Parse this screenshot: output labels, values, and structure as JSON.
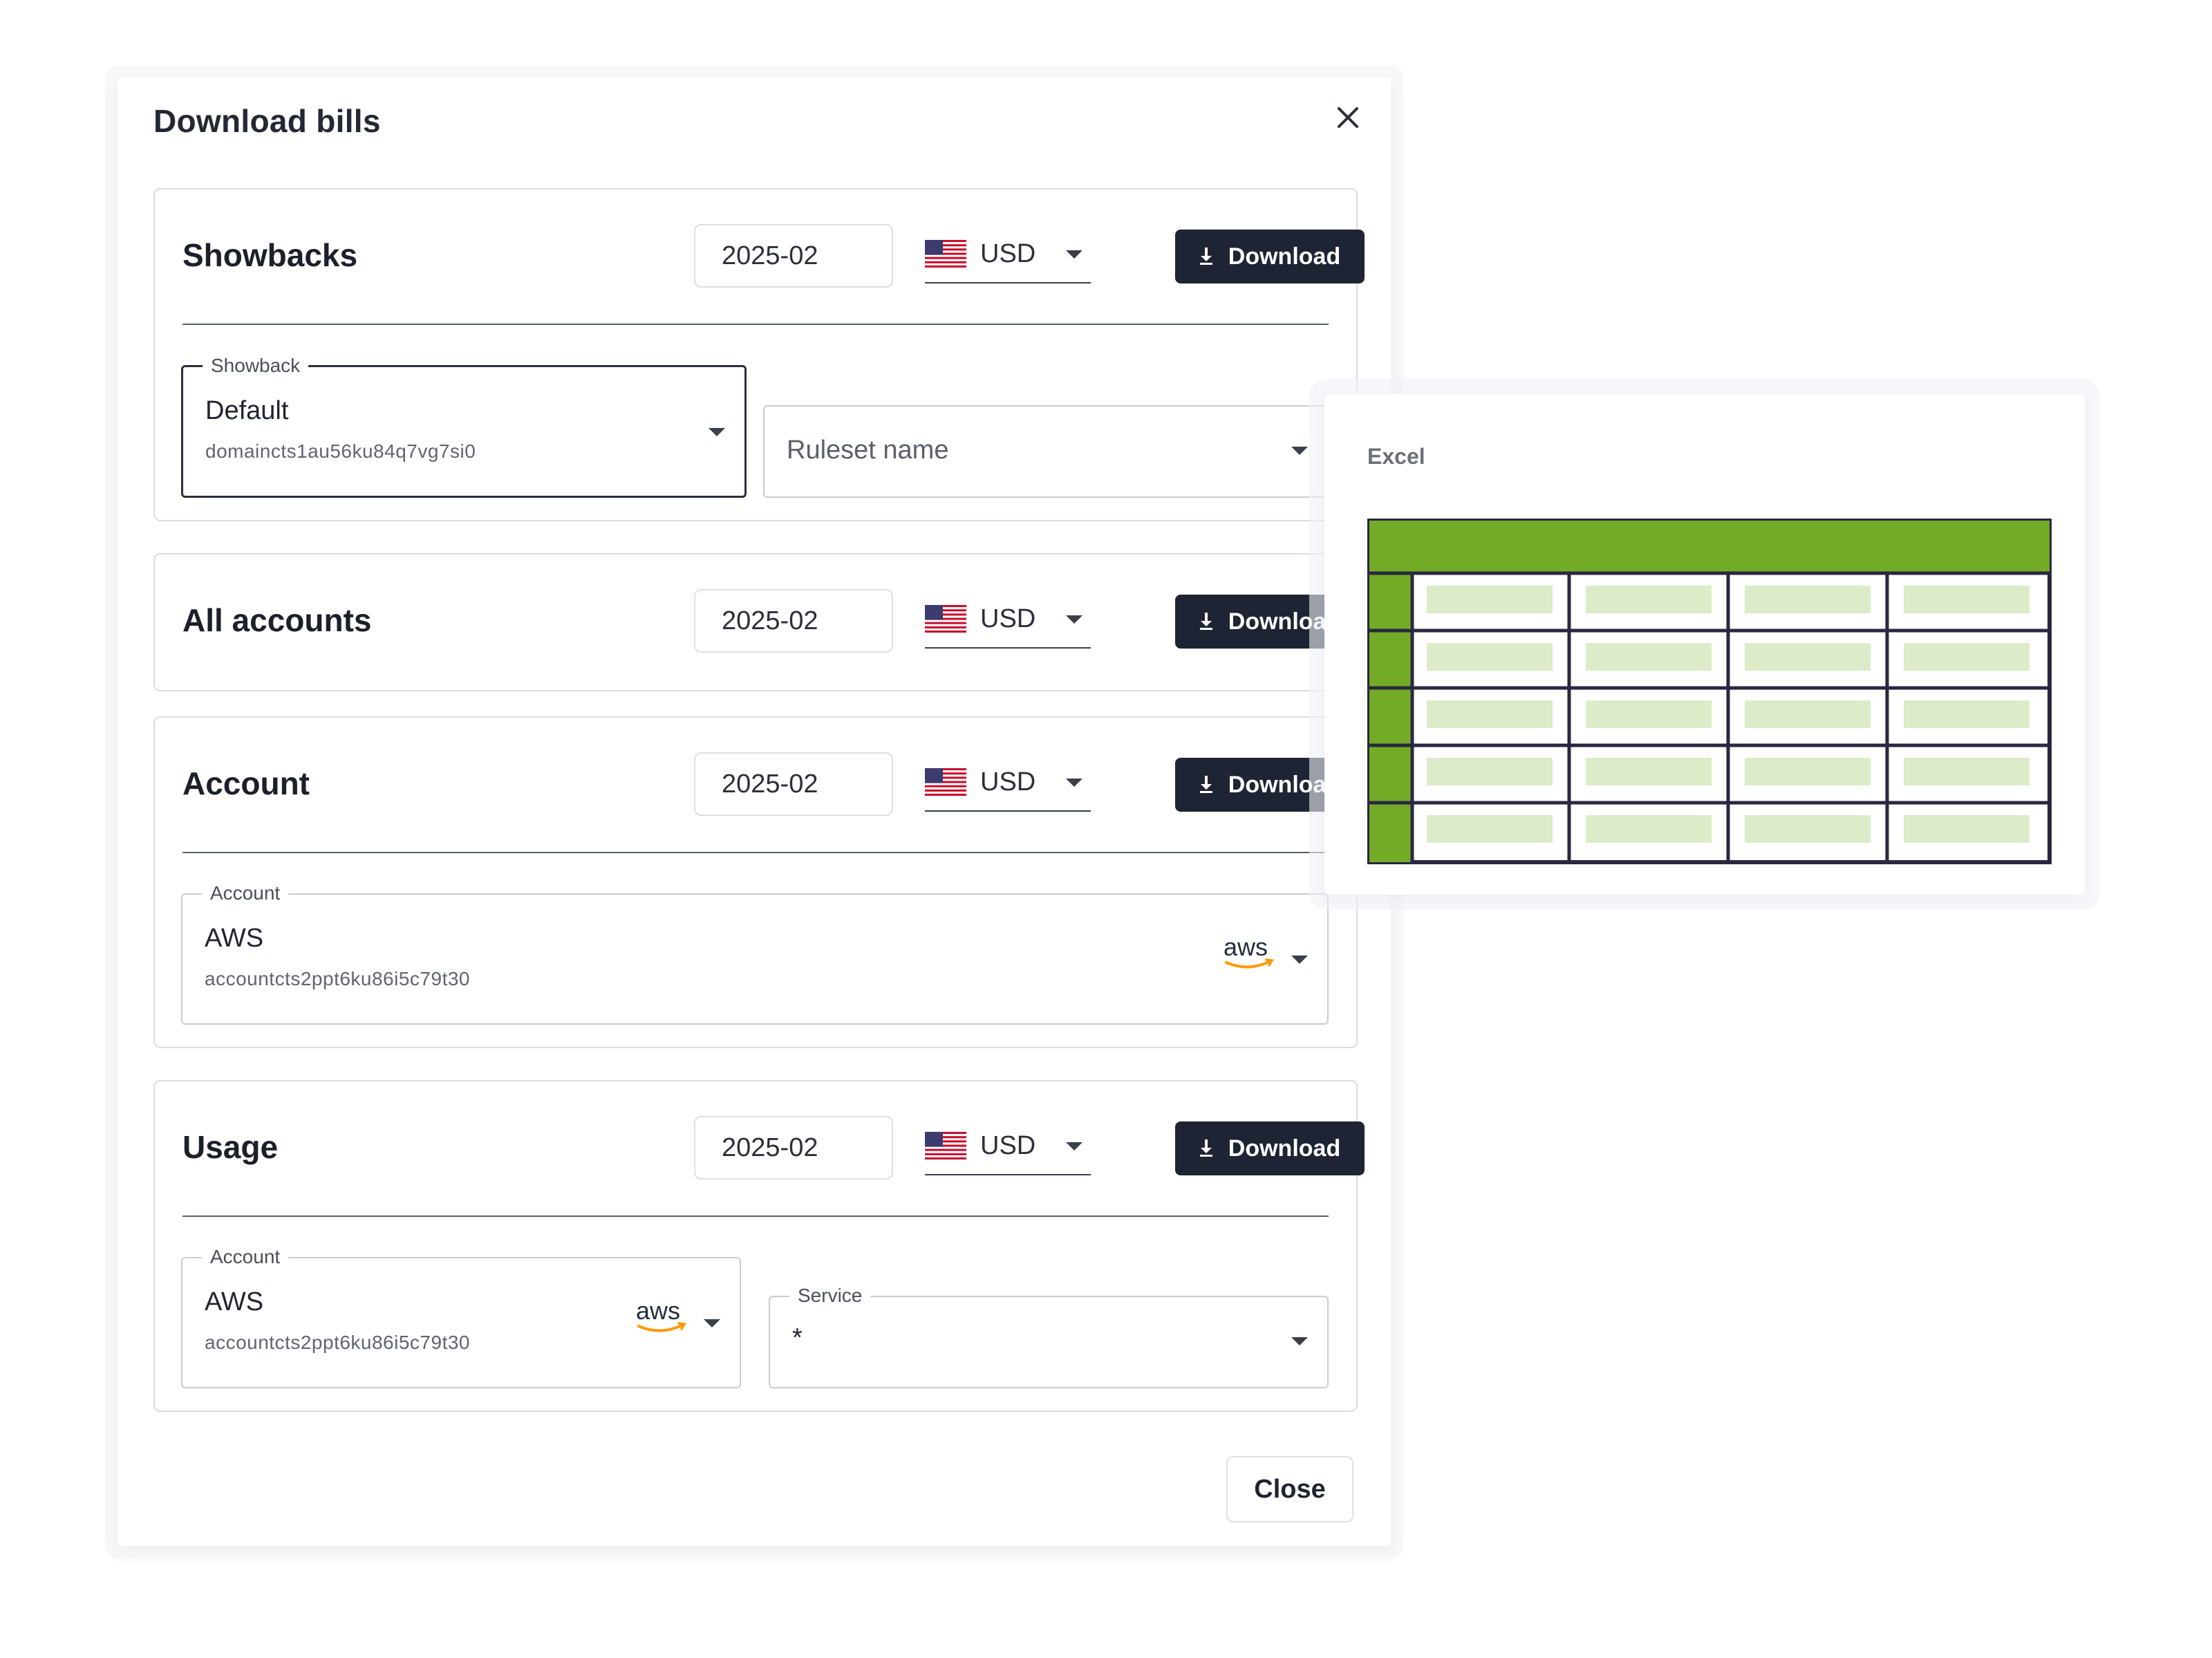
{
  "dialog": {
    "title": "Download bills",
    "close_label": "Close"
  },
  "sections": {
    "showbacks": {
      "title": "Showbacks",
      "date": "2025-02",
      "currency": "USD",
      "download_label": "Download",
      "showback_select": {
        "label": "Showback",
        "value": "Default",
        "sub": "domaincts1au56ku84q7vg7si0"
      },
      "ruleset_select": {
        "placeholder": "Ruleset name"
      }
    },
    "all_accounts": {
      "title": "All accounts",
      "date": "2025-02",
      "currency": "USD",
      "download_label": "Download"
    },
    "account": {
      "title": "Account",
      "date": "2025-02",
      "currency": "USD",
      "download_label": "Download",
      "account_select": {
        "label": "Account",
        "value": "AWS",
        "sub": "accountcts2ppt6ku86i5c79t30"
      }
    },
    "usage": {
      "title": "Usage",
      "date": "2025-02",
      "currency": "USD",
      "download_label": "Download",
      "account_select": {
        "label": "Account",
        "value": "AWS",
        "sub": "accountcts2ppt6ku86i5c79t30"
      },
      "service_select": {
        "label": "Service",
        "value": "*"
      }
    }
  },
  "excel_panel": {
    "label": "Excel"
  },
  "logos": {
    "aws": "aws"
  },
  "icons": {
    "close": "close-icon",
    "download": "download-icon",
    "caret": "caret-down-icon",
    "flag": "us-flag-icon"
  },
  "colors": {
    "button_bg": "#1e2433",
    "excel_green": "#73ab27",
    "excel_cell": "#dcebc8",
    "aws_orange": "#ff9900"
  }
}
